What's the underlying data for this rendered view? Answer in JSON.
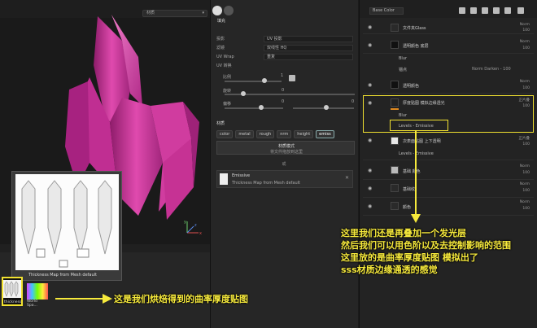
{
  "viewport": {
    "mode_select": "材质",
    "axis_x": "x",
    "axis_y": "y",
    "axis_z": "z"
  },
  "tooltip": {
    "caption": "Thickness Map from Mesh default"
  },
  "shelf": {
    "thumb1_label": "thickness",
    "thumb2_label": "World Spa..."
  },
  "properties": {
    "section_fill": "填充",
    "rows": [
      {
        "key": "投影",
        "value": "UV 投影"
      },
      {
        "key": "滤镜",
        "value": "双线性 HQ"
      },
      {
        "key": "UV Wrap",
        "value": "重复"
      }
    ],
    "uv_transform": "UV 转换",
    "tiling_label": "比例",
    "tiling_value": "1",
    "rotation_label": "旋转",
    "rotation_value": "0",
    "offset_label": "偏移",
    "offset_value_a": "0",
    "offset_value_b": "0",
    "material_label": "材质",
    "channels": [
      "color",
      "metal",
      "rough",
      "nrm",
      "height",
      "emiss"
    ],
    "material_mode_title": "材质模式",
    "material_mode_sub": "将文件拖放到这里",
    "divider": "或",
    "source_name": "Emissive",
    "source_desc": "Thickness Map from Mesh default"
  },
  "layers": {
    "blend_mode": "Base Color",
    "items": [
      {
        "name": "文件夹Glass",
        "blend": "Norm",
        "opacity": "100"
      },
      {
        "name": "透明颜色 底层",
        "blend": "Norm",
        "opacity": "100"
      },
      {
        "name": "透明颜色",
        "blend": "Norm",
        "opacity": "100"
      },
      {
        "name": "厚度贴图 模拟边缘透光",
        "blend": "正片叠",
        "opacity": "100"
      },
      {
        "name": "次表面贴图 上下透明",
        "blend": "正片叠",
        "opacity": "100"
      },
      {
        "name": "基础 颜色",
        "blend": "Norm",
        "opacity": "100"
      },
      {
        "name": "基础纹",
        "blend": "Norm",
        "opacity": "100"
      },
      {
        "name": "颜色",
        "blend": "Norm",
        "opacity": "100"
      }
    ],
    "sub_blur_1": "Blur",
    "sub_anchor": "锚点",
    "sub_anchor_val": "Norm Darken - 100",
    "sub_blur_2": "Blur",
    "sub_levels_1": "Levels - Emissive",
    "sub_levels_2": "Levels - Emissive"
  },
  "annotations": {
    "left_note": "这是我们烘焙得到的曲率厚度贴图",
    "right_note_lines": [
      "这里我们还是再叠加一个发光层",
      "然后我们可以用色阶以及去控制影响的范围",
      "这里放的是曲率厚度贴图 模拟出了",
      "sss材质边缘通透的感觉"
    ]
  },
  "colors": {
    "highlight": "#f2e230",
    "crystal": "#d0339b",
    "note": "#f7ea3c"
  }
}
